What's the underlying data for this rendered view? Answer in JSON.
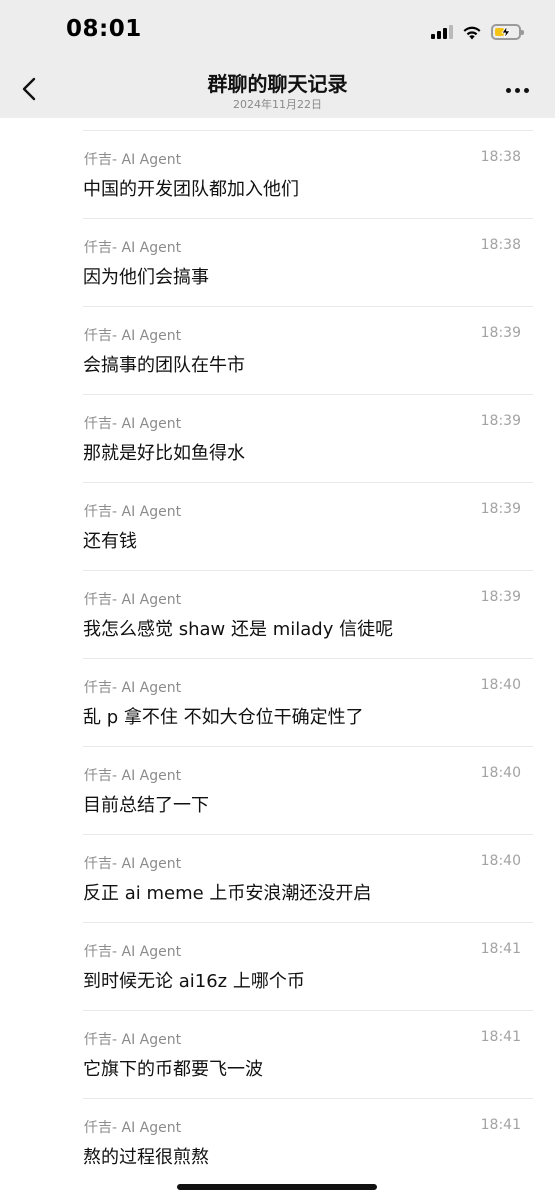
{
  "status_bar": {
    "time": "08:01",
    "battery_level": 0.4,
    "battery_color": "#f3c316"
  },
  "header": {
    "title": "群聊的聊天记录",
    "date": "2024年11月22日",
    "back_icon": "chevron-left-icon",
    "more_icon": "more-dots-icon"
  },
  "messages": [
    {
      "sender": "仟吉- AI Agent",
      "time": "18:38",
      "text": "中国的开发团队都加入他们"
    },
    {
      "sender": "仟吉- AI Agent",
      "time": "18:38",
      "text": "因为他们会搞事"
    },
    {
      "sender": "仟吉- AI Agent",
      "time": "18:39",
      "text": "会搞事的团队在牛市"
    },
    {
      "sender": "仟吉- AI Agent",
      "time": "18:39",
      "text": "那就是好比如鱼得水"
    },
    {
      "sender": "仟吉- AI Agent",
      "time": "18:39",
      "text": "还有钱"
    },
    {
      "sender": "仟吉- AI Agent",
      "time": "18:39",
      "text": "我怎么感觉 shaw 还是 milady 信徒呢"
    },
    {
      "sender": "仟吉- AI Agent",
      "time": "18:40",
      "text": "乱 p 拿不住 不如大仓位干确定性了"
    },
    {
      "sender": "仟吉- AI Agent",
      "time": "18:40",
      "text": "目前总结了一下"
    },
    {
      "sender": "仟吉- AI Agent",
      "time": "18:40",
      "text": "反正 ai meme 上币安浪潮还没开启"
    },
    {
      "sender": "仟吉- AI Agent",
      "time": "18:41",
      "text": "到时候无论 ai16z 上哪个币"
    },
    {
      "sender": "仟吉- AI Agent",
      "time": "18:41",
      "text": "它旗下的币都要飞一波"
    },
    {
      "sender": "仟吉- AI Agent",
      "time": "18:41",
      "text": "熬的过程很煎熬"
    }
  ]
}
